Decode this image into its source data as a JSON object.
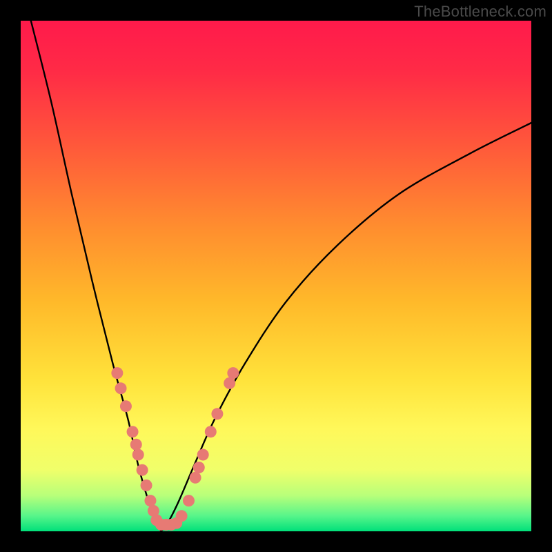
{
  "watermark": "TheBottleneck.com",
  "colors": {
    "curve": "#000000",
    "dots": "#e77a74",
    "frame": "#000000"
  },
  "chart_data": {
    "type": "line",
    "title": "",
    "xlabel": "",
    "ylabel": "",
    "xlim": [
      0,
      100
    ],
    "ylim": [
      0,
      100
    ],
    "notes": "V-shaped bottleneck curve on rainbow gradient. Apex near x≈27, y≈0. Left branch rises to top-left corner; right branch rises toward upper-right. Salmon dots cluster along the lower portion of both branches (roughly y<35).",
    "series": [
      {
        "name": "left-branch",
        "x": [
          2,
          6,
          10,
          14,
          18,
          21,
          23,
          25,
          26.5,
          27.5
        ],
        "y": [
          100,
          84,
          66,
          49,
          33,
          22,
          13,
          6,
          2,
          0
        ]
      },
      {
        "name": "right-branch",
        "x": [
          27.5,
          29,
          31,
          34,
          38,
          44,
          52,
          62,
          74,
          88,
          100
        ],
        "y": [
          0,
          2,
          6,
          13,
          22,
          33,
          45,
          56,
          66,
          74,
          80
        ]
      }
    ],
    "dots": [
      {
        "x": 18.9,
        "y": 31
      },
      {
        "x": 19.6,
        "y": 28
      },
      {
        "x": 20.6,
        "y": 24.5
      },
      {
        "x": 21.9,
        "y": 19.5
      },
      {
        "x": 22.6,
        "y": 17
      },
      {
        "x": 23.0,
        "y": 15
      },
      {
        "x": 23.8,
        "y": 12
      },
      {
        "x": 24.6,
        "y": 9
      },
      {
        "x": 25.4,
        "y": 6
      },
      {
        "x": 26.0,
        "y": 4
      },
      {
        "x": 26.6,
        "y": 2.2
      },
      {
        "x": 27.5,
        "y": 1.3
      },
      {
        "x": 28.5,
        "y": 1.3
      },
      {
        "x": 29.5,
        "y": 1.3
      },
      {
        "x": 30.5,
        "y": 1.6
      },
      {
        "x": 31.5,
        "y": 3.0
      },
      {
        "x": 32.9,
        "y": 6.0
      },
      {
        "x": 34.2,
        "y": 10.5
      },
      {
        "x": 34.9,
        "y": 12.5
      },
      {
        "x": 35.7,
        "y": 15
      },
      {
        "x": 37.2,
        "y": 19.5
      },
      {
        "x": 38.5,
        "y": 23
      },
      {
        "x": 40.9,
        "y": 29
      },
      {
        "x": 41.6,
        "y": 31
      }
    ]
  }
}
